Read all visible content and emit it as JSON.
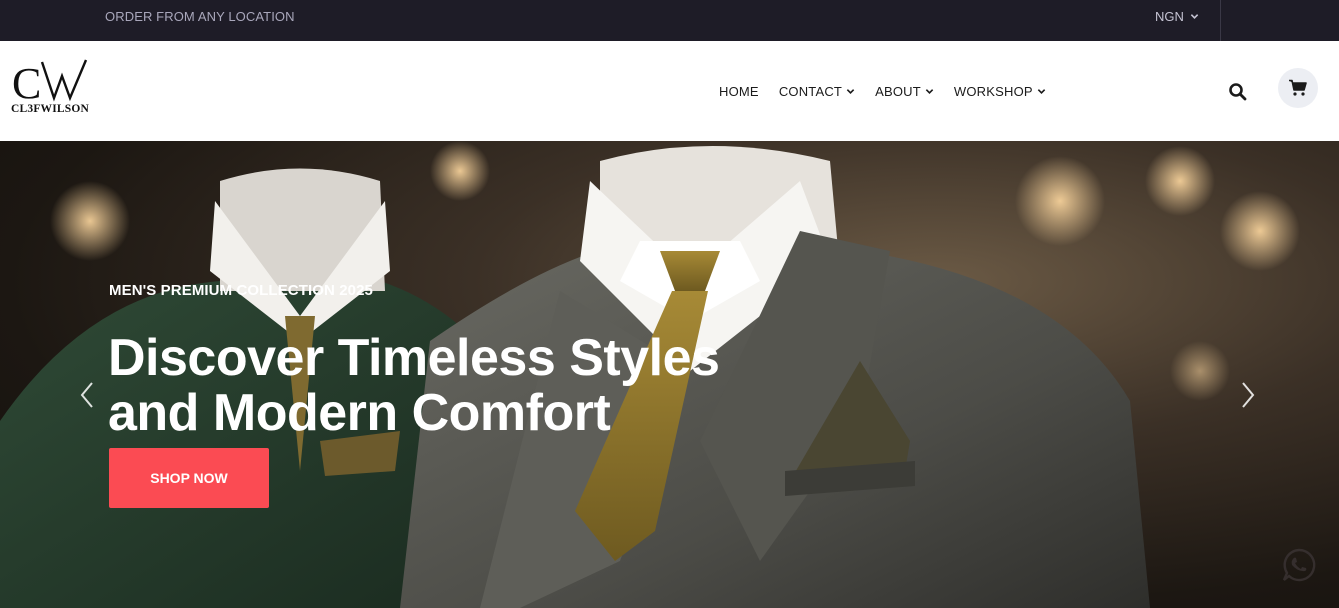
{
  "topbar": {
    "location_text": "ORDER FROM ANY LOCATION",
    "currency": "NGN"
  },
  "header": {
    "logo_mark": "CW",
    "logo_text": "CL3FWILSON",
    "nav": [
      {
        "label": "HOME",
        "has_dropdown": false
      },
      {
        "label": "CONTACT",
        "has_dropdown": true
      },
      {
        "label": "ABOUT",
        "has_dropdown": true
      },
      {
        "label": "WORKSHOP",
        "has_dropdown": true
      }
    ],
    "icons": [
      "search-icon",
      "cart-icon"
    ]
  },
  "hero": {
    "eyebrow": "MEN'S PREMIUM COLLECTION 2025",
    "headline_line1": "Discover Timeless Styles",
    "headline_line2": "and Modern Comfort",
    "cta_label": "SHOP NOW",
    "colors": {
      "cta": "#fb4b53",
      "topbar": "#1e1c27"
    }
  },
  "floating": {
    "icon": "whatsapp-icon"
  }
}
